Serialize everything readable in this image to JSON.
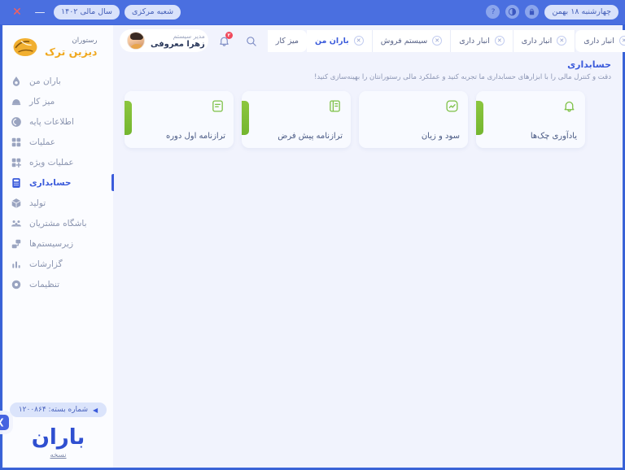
{
  "titlebar": {
    "date_pill": "چهارشنبه ۱۸ بهمن",
    "lock_icon": "lock-icon",
    "theme_icon": "theme-circle-icon",
    "help_icon": "help-icon",
    "branch_pill": "شعبه مرکزی",
    "fiscal_year_pill": "سال مالی ۱۴۰۲",
    "minimize_label": "—",
    "close_label": "✕"
  },
  "sidebar": {
    "brand_sub": "رستوران",
    "brand_name": "دیزین ترک",
    "items": [
      {
        "label": "باران من",
        "icon": "droplet-icon",
        "active": false
      },
      {
        "label": "میز کار",
        "icon": "desk-icon",
        "active": false
      },
      {
        "label": "اطلاعات پایه",
        "icon": "database-icon",
        "active": false
      },
      {
        "label": "عملیات",
        "icon": "grid-icon",
        "active": false
      },
      {
        "label": "عملیات ویژه",
        "icon": "grid-plus-icon",
        "active": false
      },
      {
        "label": "حسابداری",
        "icon": "calculator-icon",
        "active": true
      },
      {
        "label": "تولید",
        "icon": "box-icon",
        "active": false
      },
      {
        "label": "باشگاه مشتریان",
        "icon": "users-icon",
        "active": false
      },
      {
        "label": "زیرسیستم‌ها",
        "icon": "subsystems-icon",
        "active": false
      },
      {
        "label": "گزارشات",
        "icon": "bar-chart-icon",
        "active": false
      },
      {
        "label": "تنظیمات",
        "icon": "gear-icon",
        "active": false
      }
    ],
    "package_label": "شماره بسته: ۱۲۰۰۸۶۴",
    "baran_logo_text": "باران",
    "version_label": "نسخه",
    "collapse_icon": "chevron-left-icon"
  },
  "topbar": {
    "user_role": "مدیر سیستم",
    "user_name": "زهرا معروفی",
    "avatar": "user-avatar",
    "notification_icon": "bell-icon",
    "notification_badge": "۲",
    "search_icon": "search-icon",
    "tabs": [
      {
        "label": "میز کار",
        "active": false,
        "closable": false
      },
      {
        "label": "باران من",
        "active": true,
        "closable": true
      },
      {
        "label": "سیستم فروش",
        "active": false,
        "closable": true
      },
      {
        "label": "انبار داری",
        "active": false,
        "closable": true
      },
      {
        "label": "انبار داری",
        "active": false,
        "closable": true
      },
      {
        "label": "انبار داری",
        "active": false,
        "closable": true
      }
    ]
  },
  "page": {
    "title": "حسابداری",
    "subtitle": "دقت و کنترل مالی را با ابزارهای حسابداری ما تجربه کنید و عملکرد مالی رستورانتان را بهینه‌سازی کنید!",
    "cards": [
      {
        "label": "ترازنامه اول دوره",
        "icon": "clipboard-icon"
      },
      {
        "label": "ترازنامه پیش فرض",
        "icon": "book-icon"
      },
      {
        "label": "سود و زیان",
        "icon": "chart-square-icon"
      },
      {
        "label": "یادآوری چک‌ها",
        "icon": "bell-outline-icon"
      }
    ]
  },
  "colors": {
    "accent_blue": "#3b5bdb",
    "window_frame": "#4a6fe0",
    "card_green": "#8cc63f",
    "brand_orange": "#f0a81e",
    "badge_red": "#f04a5c"
  }
}
